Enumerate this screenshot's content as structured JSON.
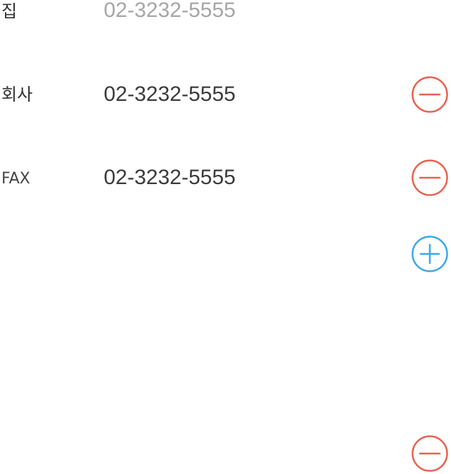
{
  "phones": {
    "home": {
      "label": "집",
      "value": "02-3232-5555"
    },
    "office": {
      "label": "회사",
      "value": "02-3232-5555"
    },
    "fax": {
      "label": "FAX",
      "value": "02-3232-5555"
    }
  },
  "icons": {
    "remove": "minus-circle-icon",
    "add": "plus-circle-icon"
  },
  "colors": {
    "remove": "#e8614f",
    "add": "#3aa8ea",
    "placeholder_text": "#a6a6a6",
    "value_text": "#3b3b3b"
  }
}
